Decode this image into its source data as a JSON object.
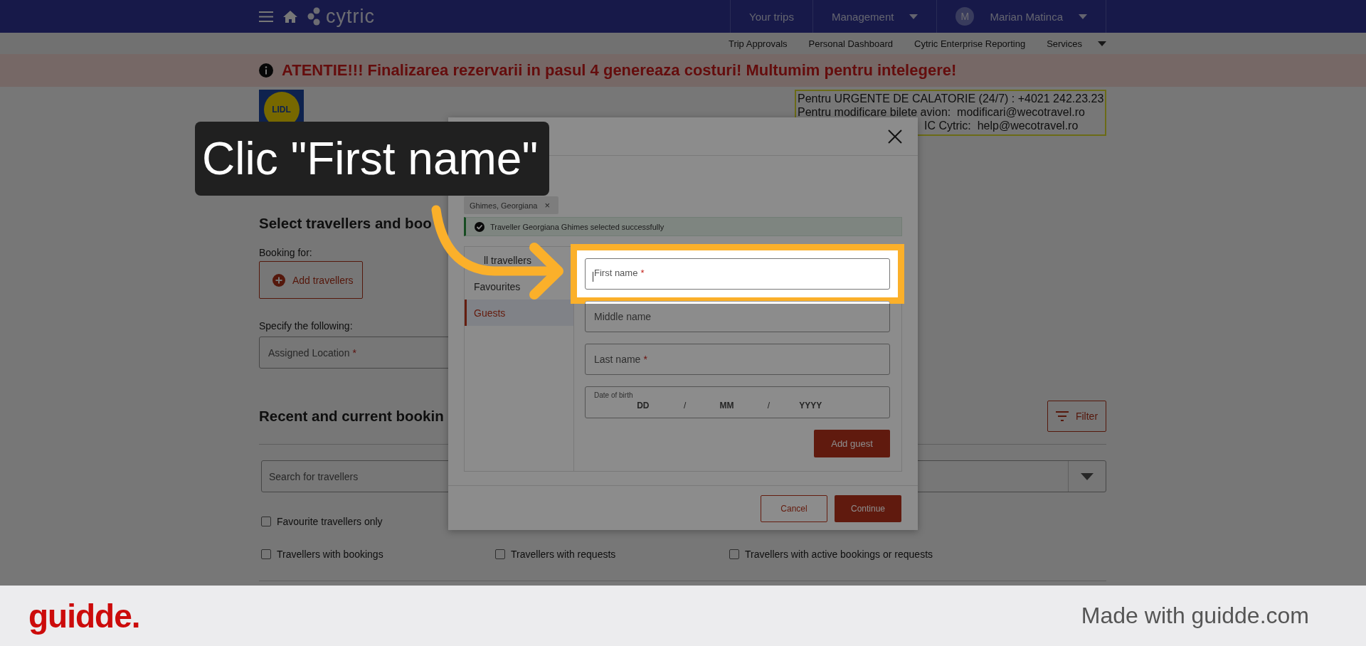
{
  "navbar": {
    "logo": "cytric",
    "links": [
      {
        "label": "Your trips",
        "dropdown": false
      },
      {
        "label": "Management",
        "dropdown": true
      }
    ],
    "user": {
      "initial": "M",
      "name": "Marian Matinca",
      "dropdown": true
    }
  },
  "subnav": [
    {
      "label": "Trip Approvals",
      "dropdown": false
    },
    {
      "label": "Personal Dashboard",
      "dropdown": false
    },
    {
      "label": "Cytric Enterprise Reporting",
      "dropdown": false
    },
    {
      "label": "Services",
      "dropdown": true
    }
  ],
  "banner": {
    "text": "ATENTIE!!! Finalizarea rezervarii in pasul 4 genereaza costuri! Multumim pentru intelegere!"
  },
  "brand_logo": {
    "text": "LIDL"
  },
  "contact_box": {
    "lines": [
      "Pentru URGENTE DE CALATORIE (24/7) : +4021 242.23.23",
      "Pentru modificare bilete avion:  modificari@wecotravel.ro",
      "IC Cytric:  help@wecotravel.ro"
    ]
  },
  "page": {
    "section_title": "Select travellers and boo",
    "booking_label": "Booking for:",
    "add_button": "Add travellers",
    "specify_label": "Specify the following:",
    "assigned_field": {
      "placeholder": "Assigned Location",
      "required_mark": "*"
    },
    "recent_title": "Recent and current bookin",
    "filter_button": "Filter",
    "search": {
      "placeholder": "Search for travellers"
    },
    "checkbox_rows": [
      [
        {
          "label": "Favourite travellers only",
          "checked": false
        }
      ],
      [
        {
          "label": "Travellers with bookings",
          "checked": false
        },
        {
          "label": "Travellers with requests",
          "checked": false
        },
        {
          "label": "Travellers with active bookings or requests",
          "checked": false
        }
      ]
    ]
  },
  "modal": {
    "chips": [
      {
        "label": "Ghimes, Georgiana",
        "remove": "×"
      }
    ],
    "alert": {
      "text": "Traveller Georgiana Ghimes selected successfully"
    },
    "tabs": [
      {
        "label": "ll travellers",
        "selected": false
      },
      {
        "label": "Favourites",
        "selected": false
      },
      {
        "label": "Guests",
        "selected": true
      }
    ],
    "fields": [
      {
        "kind": "text",
        "placeholder": "First name",
        "required_mark": "*",
        "highlighted": true
      },
      {
        "kind": "text",
        "placeholder": "Middle name",
        "highlighted": false
      },
      {
        "kind": "text",
        "placeholder": "Last name",
        "required_mark": "*",
        "highlighted": false
      },
      {
        "kind": "date",
        "label": "Date of birth",
        "parts": [
          "DD",
          "MM",
          "YYYY"
        ],
        "separator": "/",
        "highlighted": false
      }
    ],
    "add_button": "Add guest",
    "buttons": [
      {
        "label": "Cancel",
        "kind": "secondary"
      },
      {
        "label": "Continue",
        "kind": "primary"
      }
    ]
  },
  "caption": {
    "text": "Clic \"First name\""
  },
  "footer": {
    "logo": "guidde.",
    "credit": "Made with guidde.com"
  }
}
